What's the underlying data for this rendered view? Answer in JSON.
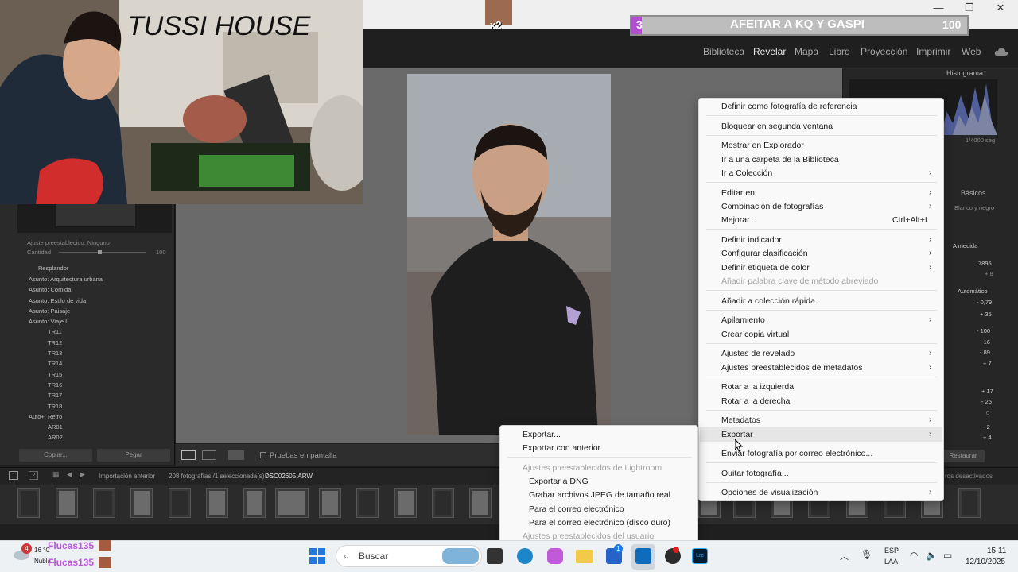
{
  "stream": {
    "title": "TUSSI HOUSE",
    "goal_text": "AFEITAR A KQ Y GASPI",
    "goal_current": "3",
    "goal_total": "100",
    "goal_progress": 0.03,
    "avatar_label": "x2",
    "donation_1": "Flucas135",
    "donation_2": "Flucas135",
    "notif_badge": "4",
    "weather_temp": "16 °C",
    "weather_desc": "Nubla..."
  },
  "window": {
    "minimize": "—",
    "maximize": "❐",
    "close": "✕"
  },
  "modules": [
    {
      "label": "Biblioteca",
      "active": false
    },
    {
      "label": "Revelar",
      "active": true
    },
    {
      "label": "Mapa",
      "active": false
    },
    {
      "label": "Libro",
      "active": false
    },
    {
      "label": "Proyección",
      "active": false
    },
    {
      "label": "Imprimir",
      "active": false
    },
    {
      "label": "Web",
      "active": false
    }
  ],
  "left_panel": {
    "preset_row": "Ajuste preestablecido: Ninguno",
    "amount_label": "Cantidad",
    "amount_value": "100",
    "items": [
      "Resplandor",
      "Asunto: Arquitectura urbana",
      "Asunto: Comida",
      "Asunto: Estilo de vida",
      "Asunto: Paisaje",
      "Asunto: Viaje II",
      "TR11",
      "TR12",
      "TR13",
      "TR14",
      "TR15",
      "TR16",
      "TR17",
      "TR18",
      "Auto+: Retro",
      "AR01",
      "AR02"
    ],
    "copy_btn": "Copiar...",
    "paste_btn": "Pegar"
  },
  "right_panel": {
    "histogram": "Histograma",
    "shutter": "1/4000 seg",
    "basic": "Básicos",
    "treatment": "Blanco y negro",
    "wb": "A medida",
    "temp": "7895",
    "tint": "+ 8",
    "auto": "Automático",
    "values": [
      "- 0,79",
      "+ 35",
      "- 100",
      "- 16",
      "- 89",
      "+ 7",
      "+ 17",
      "- 25",
      "0",
      "- 2",
      "+ 4"
    ],
    "reset_btn": "Restaurar"
  },
  "toolbar": {
    "soft_proof": "Pruebas en pantalla"
  },
  "filmstrip": {
    "page1": "1",
    "page2": "2",
    "source": "Importación anterior",
    "count": "208 fotografías /1 seleccionada(s) /",
    "filename": "DSC02605.ARW",
    "filter_status": "ros desactivados"
  },
  "context_menu": {
    "items": [
      {
        "label": "Definir como fotografía de referencia",
        "sub": false,
        "dis": false
      },
      {
        "label": "Bloquear en segunda ventana",
        "sub": false,
        "dis": false
      },
      {
        "label": "Mostrar en Explorador",
        "sub": false,
        "dis": false
      },
      {
        "label": "Ir a una carpeta de la Biblioteca",
        "sub": false,
        "dis": false
      },
      {
        "label": "Ir a Colección",
        "sub": true,
        "dis": false
      },
      {
        "label": "Editar en",
        "sub": true,
        "dis": false
      },
      {
        "label": "Combinación de fotografías",
        "sub": true,
        "dis": false
      },
      {
        "label": "Mejorar...",
        "sub": false,
        "dis": false
      },
      {
        "label": "Definir indicador",
        "sub": true,
        "dis": false
      },
      {
        "label": "Configurar clasificación",
        "sub": true,
        "dis": false
      },
      {
        "label": "Definir etiqueta de color",
        "sub": true,
        "dis": false
      },
      {
        "label": "Añadir palabra clave de método abreviado",
        "sub": false,
        "dis": true
      },
      {
        "label": "Añadir a colección rápida",
        "sub": false,
        "dis": false
      },
      {
        "label": "Apilamiento",
        "sub": true,
        "dis": false
      },
      {
        "label": "Crear copia virtual",
        "sub": false,
        "dis": false
      },
      {
        "label": "Ajustes de revelado",
        "sub": true,
        "dis": false
      },
      {
        "label": "Ajustes preestablecidos de metadatos",
        "sub": true,
        "dis": false
      },
      {
        "label": "Rotar a la izquierda",
        "sub": false,
        "dis": false
      },
      {
        "label": "Rotar a la derecha",
        "sub": false,
        "dis": false
      },
      {
        "label": "Metadatos",
        "sub": true,
        "dis": false
      },
      {
        "label": "Exportar",
        "sub": true,
        "dis": false
      },
      {
        "label": "Enviar fotografía por correo electrónico...",
        "sub": false,
        "dis": false
      },
      {
        "label": "Quitar fotografía...",
        "sub": false,
        "dis": false
      },
      {
        "label": "Opciones de visualización",
        "sub": true,
        "dis": false
      }
    ],
    "shortcut_mejorar": "Ctrl+Alt+I"
  },
  "export_submenu": {
    "items": [
      {
        "label": "Exportar...",
        "dis": false
      },
      {
        "label": "Exportar con anterior",
        "dis": false
      },
      {
        "label": "Ajustes preestablecidos de Lightroom",
        "dis": true
      },
      {
        "label": "Exportar a DNG",
        "dis": false
      },
      {
        "label": "Grabar archivos JPEG de tamaño real",
        "dis": false
      },
      {
        "label": "Para el correo electrónico",
        "dis": false
      },
      {
        "label": "Para el correo electrónico (disco duro)",
        "dis": false
      },
      {
        "label": "Ajustes preestablecidos del usuario",
        "dis": true
      }
    ]
  },
  "taskbar": {
    "search_placeholder": "Buscar",
    "lang1": "ESP",
    "lang2": "LAA",
    "time": "15:11",
    "date": "12/10/2025",
    "store_badge": "1"
  },
  "colors": {
    "accent_goal": "#b04fd0",
    "lr_bg": "#1f1f1f",
    "menu_bg": "#f9f9f9"
  }
}
